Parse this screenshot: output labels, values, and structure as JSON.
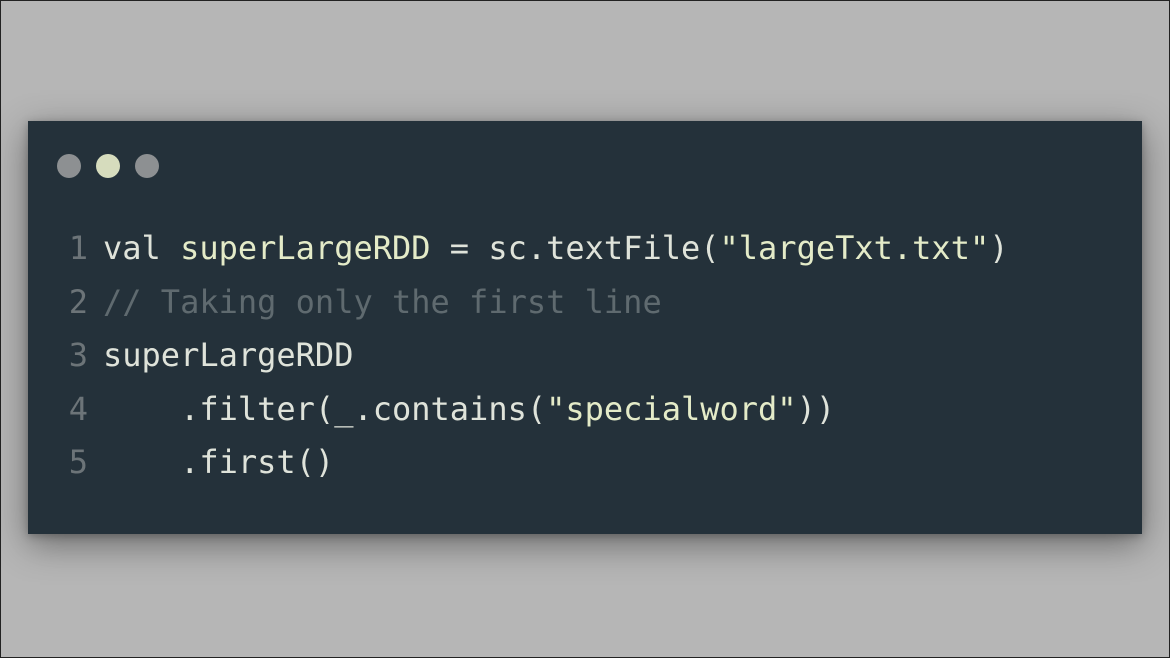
{
  "window": {
    "dots": [
      {
        "name": "dot-red",
        "color": "#8d9092"
      },
      {
        "name": "dot-yellow",
        "color": "#d6dcbd"
      },
      {
        "name": "dot-green",
        "color": "#8d9092"
      }
    ]
  },
  "code": {
    "lines": [
      {
        "number": "1",
        "tokens": [
          {
            "text": "val",
            "kind": "kw"
          },
          {
            "text": " ",
            "kind": "pl"
          },
          {
            "text": "superLargeRDD",
            "kind": "id"
          },
          {
            "text": " = sc.textFile(",
            "kind": "pl"
          },
          {
            "text": "\"largeTxt.txt\"",
            "kind": "id"
          },
          {
            "text": ")",
            "kind": "pl"
          }
        ]
      },
      {
        "number": "2",
        "tokens": [
          {
            "text": "// Taking only the first line",
            "kind": "cm"
          }
        ]
      },
      {
        "number": "3",
        "tokens": [
          {
            "text": "superLargeRDD",
            "kind": "pl"
          }
        ]
      },
      {
        "number": "4",
        "tokens": [
          {
            "text": "    .filter(_.contains(",
            "kind": "pl"
          },
          {
            "text": "\"specialword\"",
            "kind": "id"
          },
          {
            "text": "))",
            "kind": "pl"
          }
        ]
      },
      {
        "number": "5",
        "tokens": [
          {
            "text": "    .first()",
            "kind": "pl"
          }
        ]
      }
    ]
  }
}
